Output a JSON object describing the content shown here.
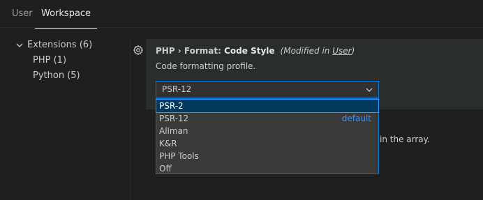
{
  "tabs": [
    {
      "label": "User"
    },
    {
      "label": "Workspace"
    }
  ],
  "tree": {
    "extensions": {
      "label": "Extensions",
      "count": "(6)"
    },
    "php": {
      "label": "PHP",
      "count": "(1)"
    },
    "python": {
      "label": "Python",
      "count": "(5)"
    }
  },
  "setting": {
    "category": "PHP › Format: ",
    "name": "Code Style",
    "modified_prefix": "(Modified in ",
    "modified_link": "User",
    "modified_suffix": ")",
    "description": "Code formatting profile.",
    "selected_value": "PSR-12"
  },
  "dropdown": {
    "options": [
      "PSR-2",
      "PSR-12",
      "Allman",
      "K&R",
      "PHP Tools",
      "Off"
    ],
    "default_label": "default"
  },
  "background_text": "in the array.",
  "colors": {
    "accent": "#0078d4",
    "link": "#3794ff",
    "background": "#1f1f1f",
    "setting_highlight": "#2a2d2e"
  },
  "icons": {
    "tree_toggle": "chevron-down-icon",
    "setting_menu": "gear-icon",
    "select": "chevron-down-icon"
  }
}
